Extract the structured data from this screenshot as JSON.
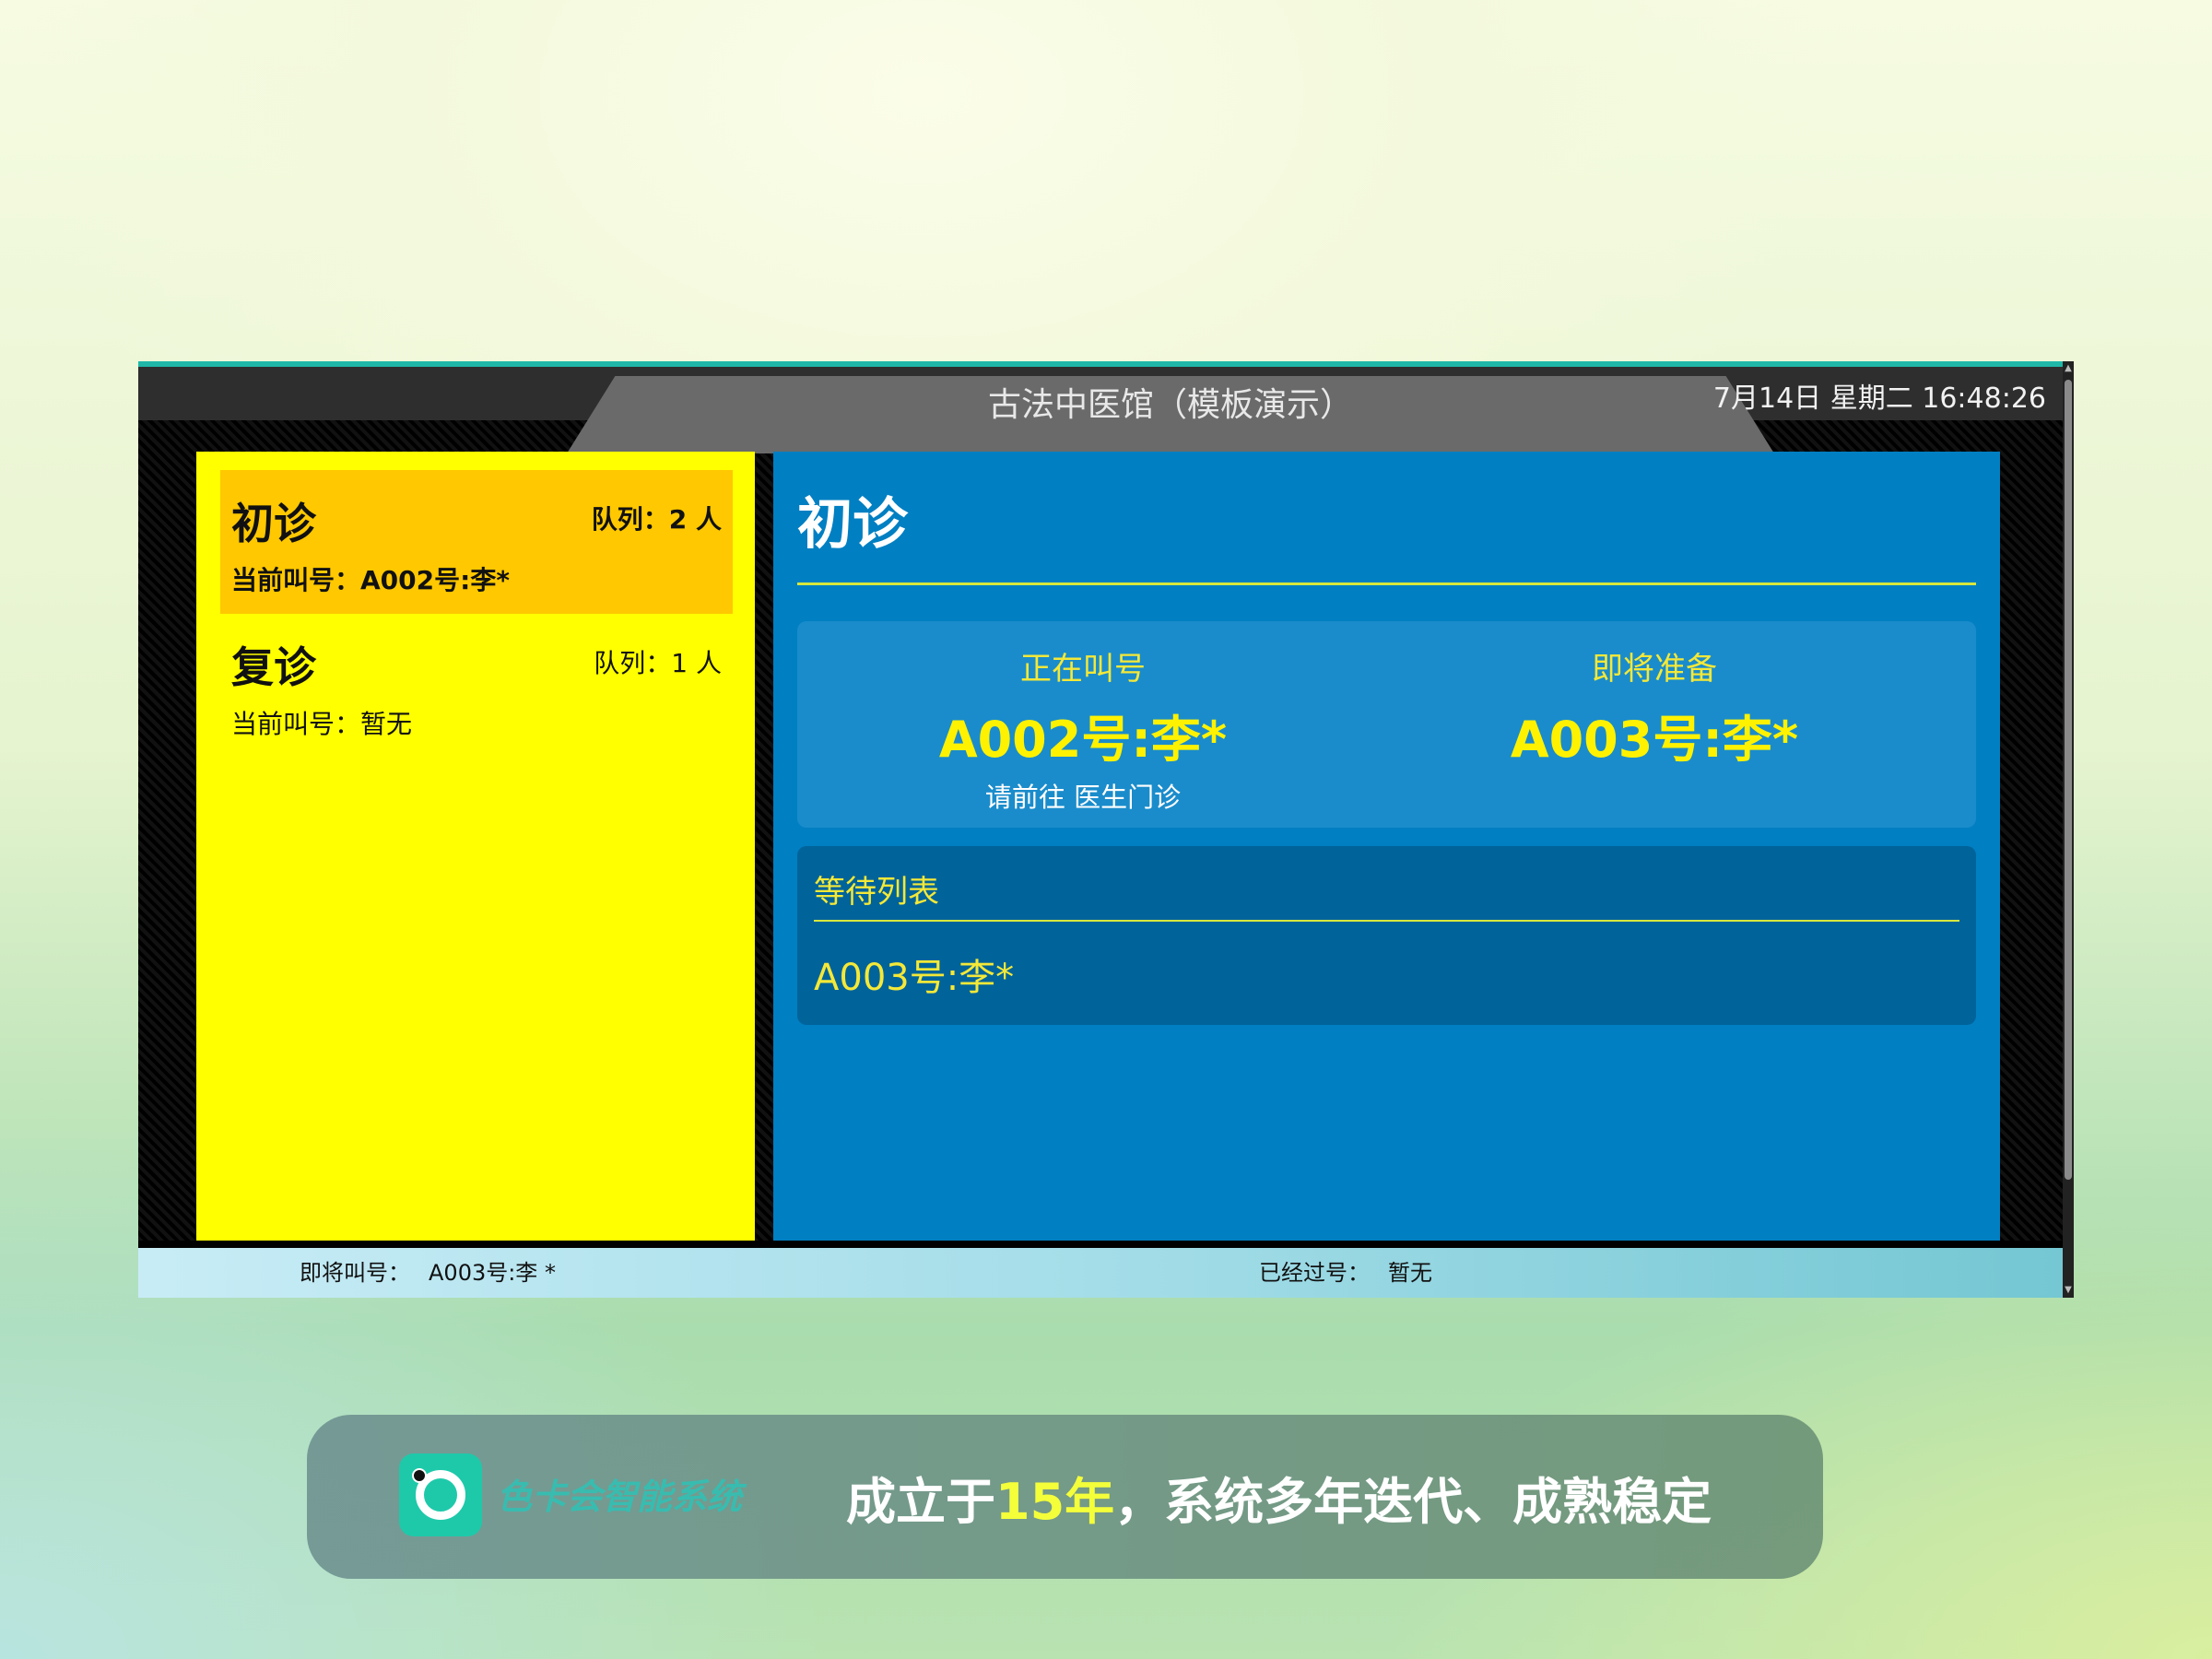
{
  "header": {
    "title": "古法中医馆（模板演示）",
    "datetime": "7月14日 星期二 16:48:26"
  },
  "queues": [
    {
      "name": "初诊",
      "count_label": "队列：",
      "count": "2 人",
      "current_label": "当前叫号：",
      "current": "A002号:李*",
      "active": true
    },
    {
      "name": "复诊",
      "count_label": "队列：",
      "count": "1 人",
      "current_label": "当前叫号：",
      "current": "暂无",
      "active": false
    }
  ],
  "detail": {
    "title": "初诊",
    "calling": {
      "label": "正在叫号",
      "number": "A002号:李*",
      "note": "请前往 医生门诊"
    },
    "preparing": {
      "label": "即将准备",
      "number": "A003号:李*"
    },
    "waiting": {
      "title": "等待列表",
      "items": [
        "A003号:李*"
      ]
    }
  },
  "footer": {
    "next_label": "即将叫号：",
    "next_value": "A003号:李 *",
    "passed_label": "已经过号：",
    "passed_value": "暂无"
  },
  "banner": {
    "brand": "色卡会智能系统",
    "slogan_pre": "成立于",
    "slogan_highlight": "15年",
    "slogan_post": "，系统多年迭代、成熟稳定"
  },
  "scrollbar": {
    "up": "▲",
    "down": "▼"
  },
  "icons": {
    "logo": "brand-logo-icon",
    "scroll_up": "triangle-up-icon",
    "scroll_down": "triangle-down-icon"
  },
  "colors": {
    "accent_teal": "#1fb8a8",
    "queue_panel": "#ffff00",
    "queue_active": "#ffc800",
    "detail_panel": "#007fc2",
    "highlight_yellow": "#fff200"
  }
}
